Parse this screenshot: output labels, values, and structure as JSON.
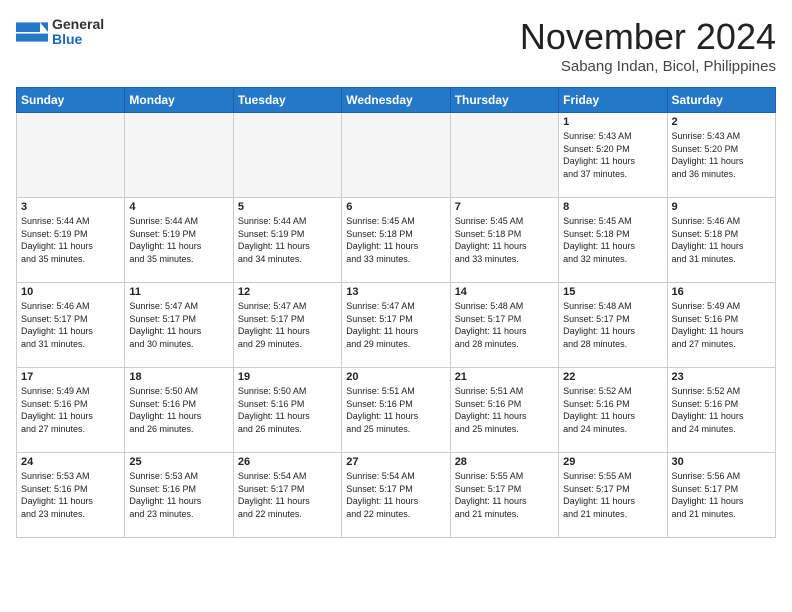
{
  "header": {
    "logo_general": "General",
    "logo_blue": "Blue",
    "month": "November 2024",
    "location": "Sabang Indan, Bicol, Philippines"
  },
  "weekdays": [
    "Sunday",
    "Monday",
    "Tuesday",
    "Wednesday",
    "Thursday",
    "Friday",
    "Saturday"
  ],
  "weeks": [
    [
      {
        "day": "",
        "info": ""
      },
      {
        "day": "",
        "info": ""
      },
      {
        "day": "",
        "info": ""
      },
      {
        "day": "",
        "info": ""
      },
      {
        "day": "",
        "info": ""
      },
      {
        "day": "1",
        "info": "Sunrise: 5:43 AM\nSunset: 5:20 PM\nDaylight: 11 hours\nand 37 minutes."
      },
      {
        "day": "2",
        "info": "Sunrise: 5:43 AM\nSunset: 5:20 PM\nDaylight: 11 hours\nand 36 minutes."
      }
    ],
    [
      {
        "day": "3",
        "info": "Sunrise: 5:44 AM\nSunset: 5:19 PM\nDaylight: 11 hours\nand 35 minutes."
      },
      {
        "day": "4",
        "info": "Sunrise: 5:44 AM\nSunset: 5:19 PM\nDaylight: 11 hours\nand 35 minutes."
      },
      {
        "day": "5",
        "info": "Sunrise: 5:44 AM\nSunset: 5:19 PM\nDaylight: 11 hours\nand 34 minutes."
      },
      {
        "day": "6",
        "info": "Sunrise: 5:45 AM\nSunset: 5:18 PM\nDaylight: 11 hours\nand 33 minutes."
      },
      {
        "day": "7",
        "info": "Sunrise: 5:45 AM\nSunset: 5:18 PM\nDaylight: 11 hours\nand 33 minutes."
      },
      {
        "day": "8",
        "info": "Sunrise: 5:45 AM\nSunset: 5:18 PM\nDaylight: 11 hours\nand 32 minutes."
      },
      {
        "day": "9",
        "info": "Sunrise: 5:46 AM\nSunset: 5:18 PM\nDaylight: 11 hours\nand 31 minutes."
      }
    ],
    [
      {
        "day": "10",
        "info": "Sunrise: 5:46 AM\nSunset: 5:17 PM\nDaylight: 11 hours\nand 31 minutes."
      },
      {
        "day": "11",
        "info": "Sunrise: 5:47 AM\nSunset: 5:17 PM\nDaylight: 11 hours\nand 30 minutes."
      },
      {
        "day": "12",
        "info": "Sunrise: 5:47 AM\nSunset: 5:17 PM\nDaylight: 11 hours\nand 29 minutes."
      },
      {
        "day": "13",
        "info": "Sunrise: 5:47 AM\nSunset: 5:17 PM\nDaylight: 11 hours\nand 29 minutes."
      },
      {
        "day": "14",
        "info": "Sunrise: 5:48 AM\nSunset: 5:17 PM\nDaylight: 11 hours\nand 28 minutes."
      },
      {
        "day": "15",
        "info": "Sunrise: 5:48 AM\nSunset: 5:17 PM\nDaylight: 11 hours\nand 28 minutes."
      },
      {
        "day": "16",
        "info": "Sunrise: 5:49 AM\nSunset: 5:16 PM\nDaylight: 11 hours\nand 27 minutes."
      }
    ],
    [
      {
        "day": "17",
        "info": "Sunrise: 5:49 AM\nSunset: 5:16 PM\nDaylight: 11 hours\nand 27 minutes."
      },
      {
        "day": "18",
        "info": "Sunrise: 5:50 AM\nSunset: 5:16 PM\nDaylight: 11 hours\nand 26 minutes."
      },
      {
        "day": "19",
        "info": "Sunrise: 5:50 AM\nSunset: 5:16 PM\nDaylight: 11 hours\nand 26 minutes."
      },
      {
        "day": "20",
        "info": "Sunrise: 5:51 AM\nSunset: 5:16 PM\nDaylight: 11 hours\nand 25 minutes."
      },
      {
        "day": "21",
        "info": "Sunrise: 5:51 AM\nSunset: 5:16 PM\nDaylight: 11 hours\nand 25 minutes."
      },
      {
        "day": "22",
        "info": "Sunrise: 5:52 AM\nSunset: 5:16 PM\nDaylight: 11 hours\nand 24 minutes."
      },
      {
        "day": "23",
        "info": "Sunrise: 5:52 AM\nSunset: 5:16 PM\nDaylight: 11 hours\nand 24 minutes."
      }
    ],
    [
      {
        "day": "24",
        "info": "Sunrise: 5:53 AM\nSunset: 5:16 PM\nDaylight: 11 hours\nand 23 minutes."
      },
      {
        "day": "25",
        "info": "Sunrise: 5:53 AM\nSunset: 5:16 PM\nDaylight: 11 hours\nand 23 minutes."
      },
      {
        "day": "26",
        "info": "Sunrise: 5:54 AM\nSunset: 5:17 PM\nDaylight: 11 hours\nand 22 minutes."
      },
      {
        "day": "27",
        "info": "Sunrise: 5:54 AM\nSunset: 5:17 PM\nDaylight: 11 hours\nand 22 minutes."
      },
      {
        "day": "28",
        "info": "Sunrise: 5:55 AM\nSunset: 5:17 PM\nDaylight: 11 hours\nand 21 minutes."
      },
      {
        "day": "29",
        "info": "Sunrise: 5:55 AM\nSunset: 5:17 PM\nDaylight: 11 hours\nand 21 minutes."
      },
      {
        "day": "30",
        "info": "Sunrise: 5:56 AM\nSunset: 5:17 PM\nDaylight: 11 hours\nand 21 minutes."
      }
    ]
  ]
}
